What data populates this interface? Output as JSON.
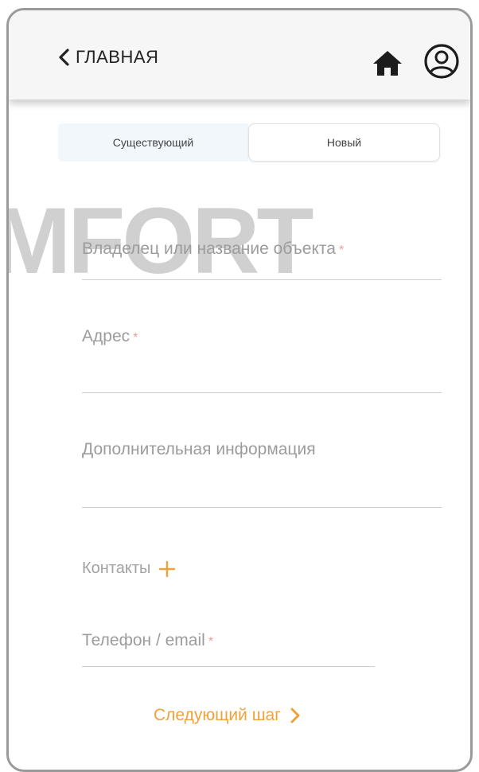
{
  "header": {
    "back_label": "ГЛАВНАЯ",
    "icons": [
      "chevron-left-icon",
      "home-icon",
      "user-circle-icon"
    ]
  },
  "segment": {
    "existing_label": "Существующий",
    "new_label": "Новый",
    "selected": "Новый"
  },
  "watermark": "MFORT",
  "form": {
    "owner_label": "Владелец или название объекта",
    "address_label": "Адрес",
    "info_label": "Дополнительная информация",
    "contacts_label": "Контакты",
    "contact_label": "Телефон / email",
    "required_mark": "*"
  },
  "footer": {
    "next_label": "Следующий шаг"
  },
  "colors": {
    "accent": "#f0a23a",
    "required": "#e8a0a0",
    "header_bg": "#f6f6f6",
    "segment_selected_bg": "#f1f7fb"
  }
}
